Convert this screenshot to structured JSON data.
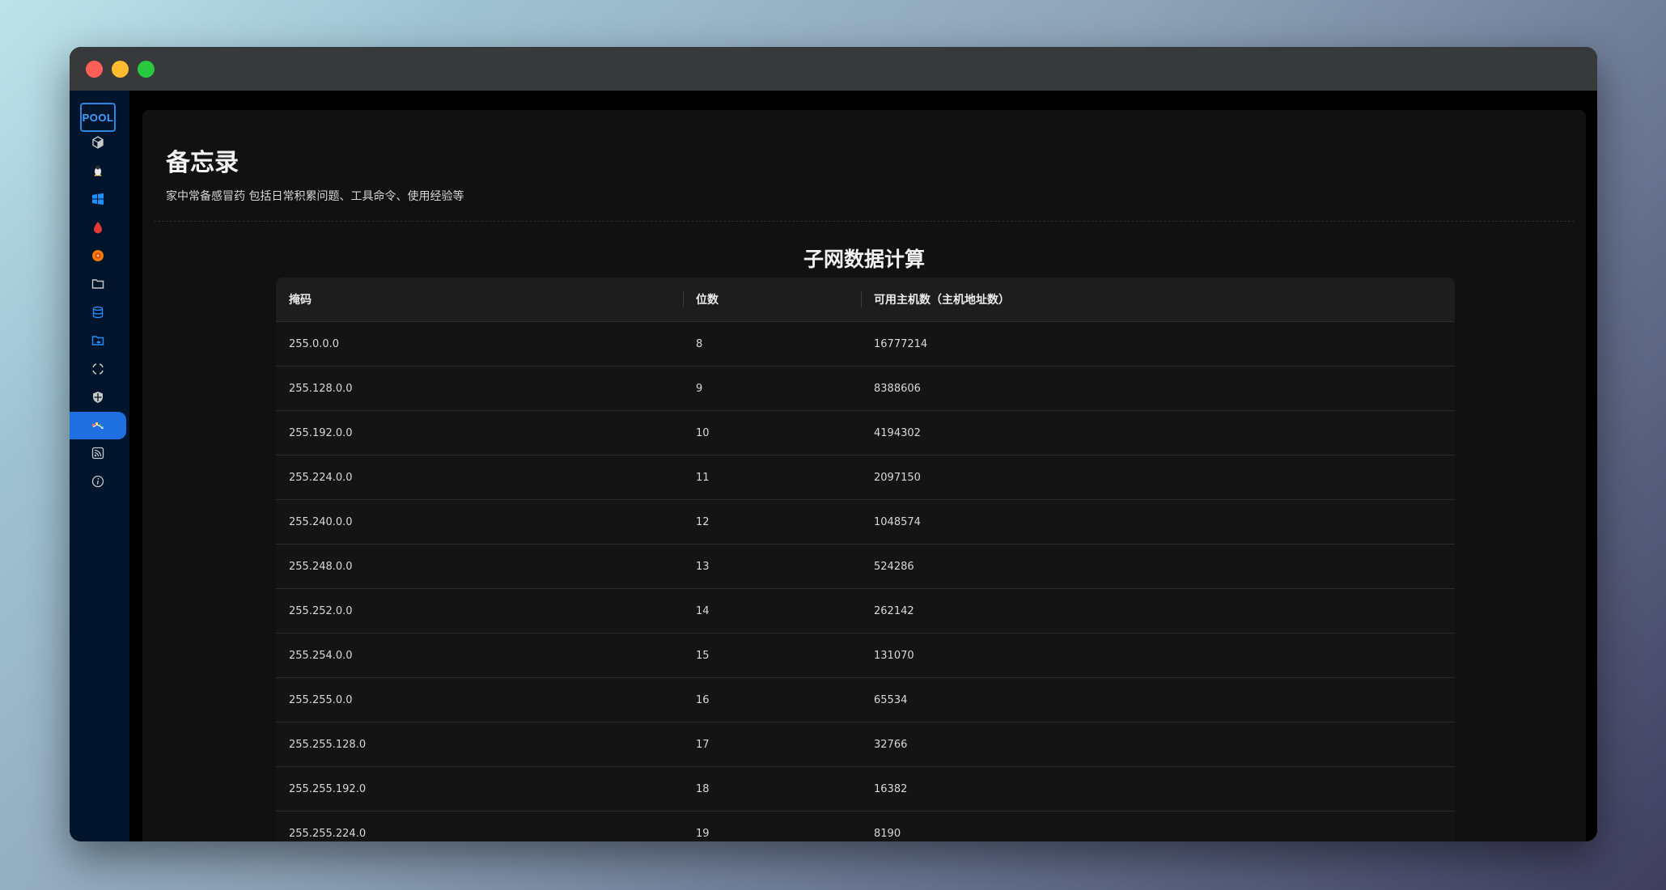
{
  "window": {
    "controls": [
      "close",
      "minimize",
      "maximize"
    ]
  },
  "sidebar": {
    "logo": "POOL",
    "items": [
      {
        "icon": "cube-icon",
        "color": "#c8c8c8"
      },
      {
        "icon": "linux-icon",
        "color": "#f0c419"
      },
      {
        "icon": "windows-icon",
        "color": "#1e90ff"
      },
      {
        "icon": "drop-icon",
        "color": "#e53935"
      },
      {
        "icon": "target-icon",
        "color": "#f57c00"
      },
      {
        "icon": "folder-icon",
        "color": "#c8c8c8"
      },
      {
        "icon": "database-icon",
        "color": "#1e90ff"
      },
      {
        "icon": "folder-share-icon",
        "color": "#1e90ff"
      },
      {
        "icon": "scan-icon",
        "color": "#c8c8c8"
      },
      {
        "icon": "shield-icon",
        "color": "#c8c8c8"
      },
      {
        "icon": "network-icon",
        "color": "#4caf50",
        "active": true
      },
      {
        "icon": "rss-icon",
        "color": "#c8c8c8"
      },
      {
        "icon": "info-icon",
        "color": "#c8c8c8"
      }
    ]
  },
  "page": {
    "title": "备忘录",
    "description": "家中常备感冒药 包括日常积累问题、工具命令、使用经验等"
  },
  "section": {
    "title": "子网数据计算",
    "columns": [
      "掩码",
      "位数",
      "可用主机数（主机地址数）"
    ],
    "rows": [
      [
        "255.0.0.0",
        "8",
        "16777214"
      ],
      [
        "255.128.0.0",
        "9",
        "8388606"
      ],
      [
        "255.192.0.0",
        "10",
        "4194302"
      ],
      [
        "255.224.0.0",
        "11",
        "2097150"
      ],
      [
        "255.240.0.0",
        "12",
        "1048574"
      ],
      [
        "255.248.0.0",
        "13",
        "524286"
      ],
      [
        "255.252.0.0",
        "14",
        "262142"
      ],
      [
        "255.254.0.0",
        "15",
        "131070"
      ],
      [
        "255.255.0.0",
        "16",
        "65534"
      ],
      [
        "255.255.128.0",
        "17",
        "32766"
      ],
      [
        "255.255.192.0",
        "18",
        "16382"
      ],
      [
        "255.255.224.0",
        "19",
        "8190"
      ]
    ]
  }
}
